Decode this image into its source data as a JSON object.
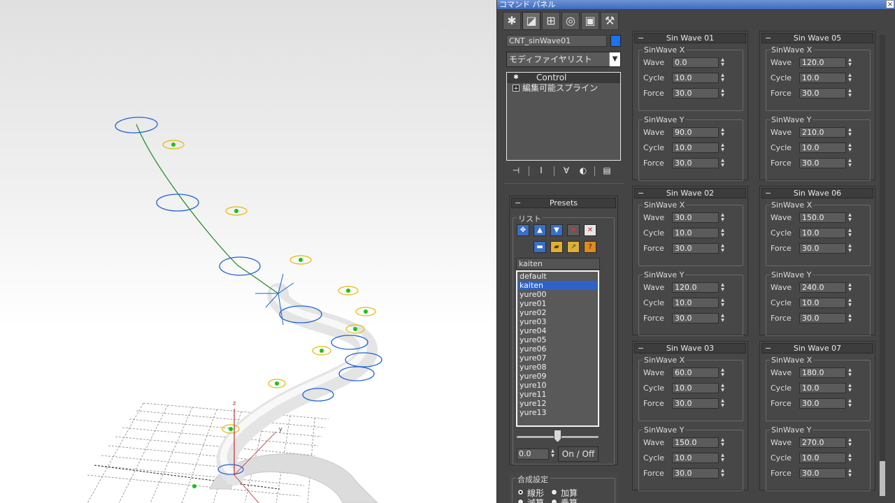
{
  "window": {
    "title": "コマンド パネル",
    "close_label": "×"
  },
  "toolbar": {
    "tabs": [
      {
        "icon": "gear-icon",
        "glyph": "✱"
      },
      {
        "icon": "modify-icon",
        "glyph": "◪"
      },
      {
        "icon": "hierarchy-icon",
        "glyph": "⊞"
      },
      {
        "icon": "motion-icon",
        "glyph": "◎"
      },
      {
        "icon": "display-icon",
        "glyph": "▣"
      },
      {
        "icon": "utilities-icon",
        "glyph": "⚒"
      }
    ]
  },
  "object": {
    "name": "CNT_sinWave01",
    "color": "#1a73f0"
  },
  "modifier_list": {
    "label": "モディファイヤリスト",
    "arrow": "▼"
  },
  "stack": {
    "items": [
      {
        "icon": "✱",
        "label": "Control",
        "selected": true
      },
      {
        "icon": "+",
        "label": "編集可能スプライン",
        "selected": false
      }
    ]
  },
  "stack_tools": [
    "⊣",
    "Ⅰ",
    "∀",
    "◐",
    "▤"
  ],
  "presets": {
    "title": "Presets",
    "minus": "−",
    "list_label": "リスト",
    "buttons_row1": [
      {
        "icon": "load-icon",
        "glyph": "✥",
        "color": "#3a6fc8"
      },
      {
        "icon": "move-up-icon",
        "glyph": "▲",
        "color": "#3a6fc8"
      },
      {
        "icon": "move-down-icon",
        "glyph": "▼",
        "color": "#3a6fc8"
      },
      {
        "icon": "delete-icon",
        "glyph": "✕",
        "color": "#c84a3a"
      },
      {
        "icon": "clear-icon",
        "glyph": "✕",
        "color": "#e5e5e5"
      }
    ],
    "buttons_row2": [
      {
        "icon": "save-icon",
        "glyph": "▬",
        "color": "#3a6fc8"
      },
      {
        "icon": "open-folder-icon",
        "glyph": "▰",
        "color": "#e0b030"
      },
      {
        "icon": "export-icon",
        "glyph": "↗",
        "color": "#e0b030"
      },
      {
        "icon": "help-icon",
        "glyph": "?",
        "color": "#e08a20"
      }
    ],
    "name_value": "kaiten",
    "items": [
      "default",
      "kaiten",
      "yure00",
      "yure01",
      "yure02",
      "yure03",
      "yure04",
      "yure05",
      "yure06",
      "yure07",
      "yure08",
      "yure09",
      "yure10",
      "yure11",
      "yure12",
      "yure13"
    ],
    "selected": "kaiten",
    "slider_value": "0.0",
    "slider_fraction": 0.5,
    "onoff_label": "On / Off"
  },
  "composite": {
    "title": "合成設定",
    "options": [
      {
        "label": "線形",
        "checked": true
      },
      {
        "label": "加算",
        "checked": false
      },
      {
        "label": "減算",
        "checked": false
      },
      {
        "label": "乗算",
        "checked": false
      }
    ]
  },
  "spinner_glyphs": {
    "up": "▲",
    "down": "▼"
  },
  "sine_waves": [
    {
      "title": "Sin Wave 01",
      "x": {
        "wave": "0.0",
        "cycle": "10.0",
        "force": "30.0"
      },
      "y": {
        "wave": "90.0",
        "cycle": "10.0",
        "force": "30.0"
      }
    },
    {
      "title": "Sin Wave 05",
      "x": {
        "wave": "120.0",
        "cycle": "10.0",
        "force": "30.0"
      },
      "y": {
        "wave": "210.0",
        "cycle": "10.0",
        "force": "30.0"
      }
    },
    {
      "title": "Sin Wave 02",
      "x": {
        "wave": "30.0",
        "cycle": "10.0",
        "force": "30.0"
      },
      "y": {
        "wave": "120.0",
        "cycle": "10.0",
        "force": "30.0"
      }
    },
    {
      "title": "Sin Wave 06",
      "x": {
        "wave": "150.0",
        "cycle": "10.0",
        "force": "30.0"
      },
      "y": {
        "wave": "240.0",
        "cycle": "10.0",
        "force": "30.0"
      }
    },
    {
      "title": "Sin Wave 03",
      "x": {
        "wave": "60.0",
        "cycle": "10.0",
        "force": "30.0"
      },
      "y": {
        "wave": "150.0",
        "cycle": "10.0",
        "force": "30.0"
      }
    },
    {
      "title": "Sin Wave 07",
      "x": {
        "wave": "180.0",
        "cycle": "10.0",
        "force": "30.0"
      },
      "y": {
        "wave": "270.0",
        "cycle": "10.0",
        "force": "30.0"
      }
    }
  ],
  "labels": {
    "sin_x": "SinWave X",
    "sin_y": "SinWave Y",
    "wave": "Wave",
    "cycle": "Cycle",
    "force": "Force"
  },
  "viewport": {
    "axis_z": "z",
    "axis_y": "y"
  }
}
